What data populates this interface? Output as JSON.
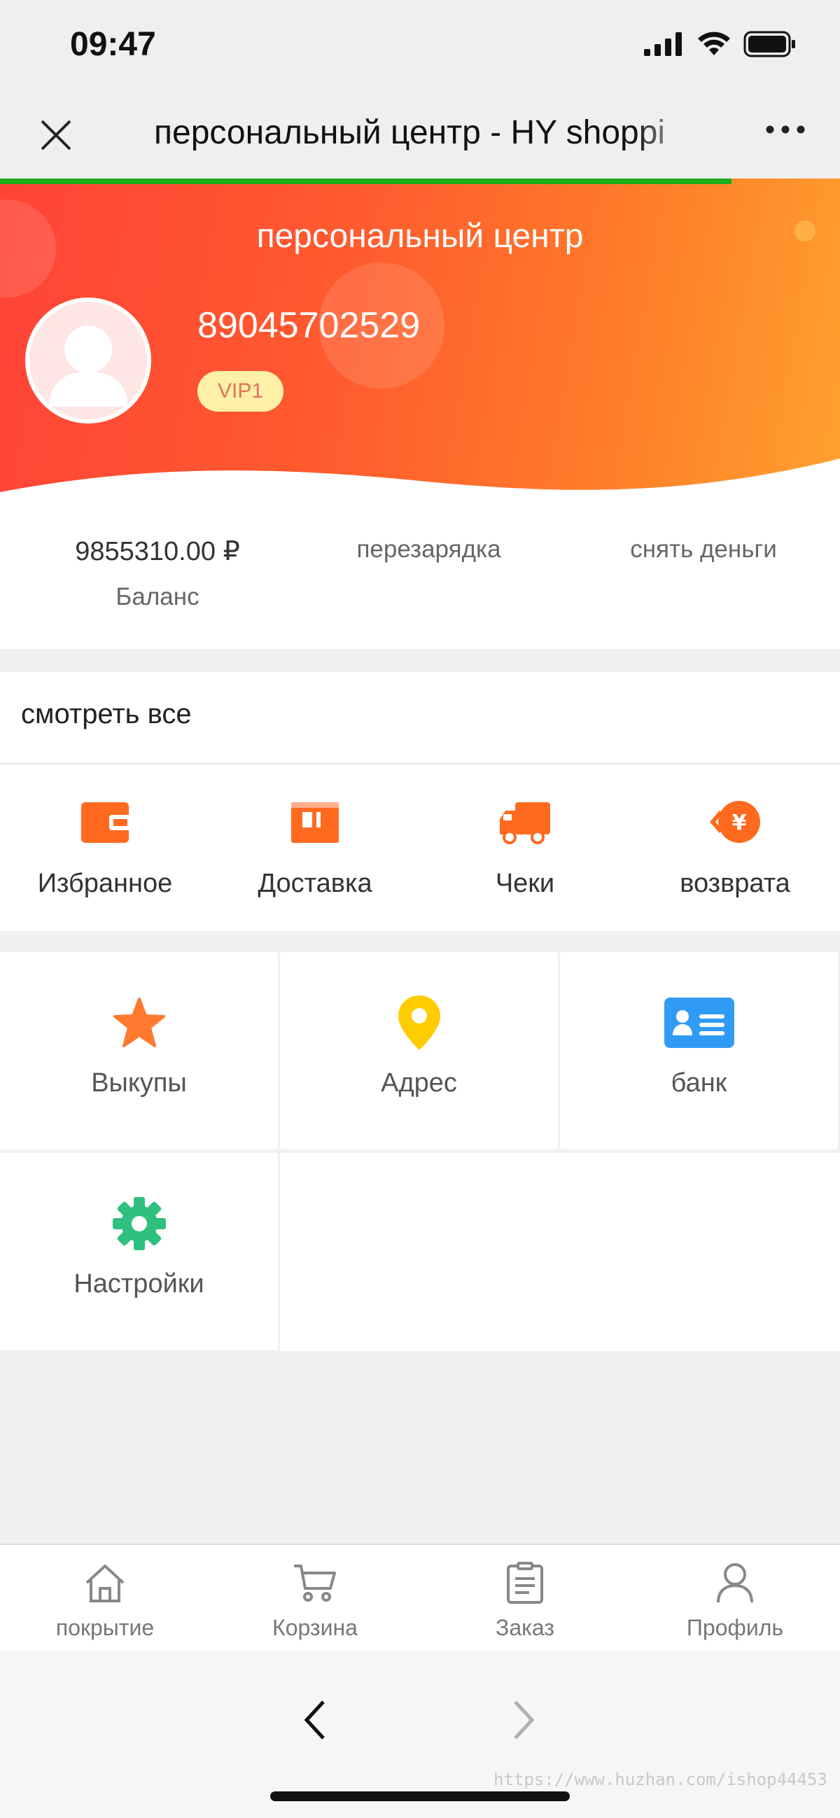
{
  "status_bar": {
    "time": "09:47"
  },
  "nav": {
    "title": "персональный центр - HY shoppi"
  },
  "header": {
    "title": "персональный центр",
    "phone": "89045702529",
    "vip": "VIP1"
  },
  "balance": {
    "value": "9855310.00 ₽",
    "label": "Баланс",
    "recharge": "перезарядка",
    "withdraw": "снять деньги"
  },
  "orders": {
    "view_all": "смотреть все",
    "items": [
      {
        "label": "Избранное",
        "icon": "wallet-icon"
      },
      {
        "label": "Доставка",
        "icon": "box-icon"
      },
      {
        "label": "Чеки",
        "icon": "truck-icon"
      },
      {
        "label": "возврата",
        "icon": "yuan-refund-icon"
      }
    ]
  },
  "services": [
    {
      "label": "Выкупы",
      "icon": "star-icon"
    },
    {
      "label": "Адрес",
      "icon": "location-pin-icon"
    },
    {
      "label": "банк",
      "icon": "id-card-icon"
    },
    {
      "label": "Настройки",
      "icon": "gear-icon"
    }
  ],
  "tabbar": [
    {
      "label": "покрытие",
      "icon": "home-icon"
    },
    {
      "label": "Корзина",
      "icon": "cart-icon"
    },
    {
      "label": "Заказ",
      "icon": "clipboard-icon"
    },
    {
      "label": "Профиль",
      "icon": "person-icon"
    }
  ],
  "watermark": "https://www.huzhan.com/ishop44453",
  "colors": {
    "header_start": "#ff4337",
    "header_end": "#ffa22e",
    "progress": "#1aad19",
    "order_icon": "#ff6a1f",
    "star": "#ff7a2e",
    "pin": "#ffcc00",
    "bank": "#2f9bf5",
    "gear": "#2fbf7f"
  }
}
